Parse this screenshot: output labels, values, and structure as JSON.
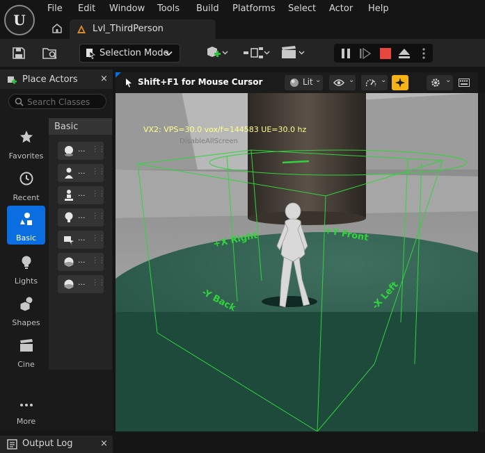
{
  "menu": {
    "items": [
      "File",
      "Edit",
      "Window",
      "Tools",
      "Build",
      "Platforms",
      "Select",
      "Actor",
      "Help"
    ]
  },
  "level_tab": {
    "label": "Lvl_ThirdPerson"
  },
  "toolbar": {
    "selection_mode_label": "Selection Mode",
    "icons": [
      "save-icon",
      "content-browser-icon",
      "add-actor-icon",
      "blueprint-icon",
      "cinematics-icon",
      "pause-icon",
      "step-icon",
      "stop-icon",
      "eject-icon",
      "more-icon"
    ]
  },
  "place_actors": {
    "title": "Place Actors",
    "close_label": "×",
    "search_placeholder": "Search Classes",
    "categories": [
      {
        "label": "Favorites",
        "icon": "star-icon"
      },
      {
        "label": "Recent",
        "icon": "clock-icon"
      },
      {
        "label": "Basic",
        "icon": "shapes-basic-icon",
        "active": true
      },
      {
        "label": "Lights",
        "icon": "lightbulb-icon"
      },
      {
        "label": "Shapes",
        "icon": "cube-icon"
      },
      {
        "label": "Cine",
        "icon": "clapperboard-icon"
      },
      {
        "label": "More",
        "icon": "ellipsis-icon"
      }
    ],
    "list_header": "Basic",
    "actors": [
      {
        "label": "...",
        "icon": "empty-actor-icon"
      },
      {
        "label": "...",
        "icon": "character-icon"
      },
      {
        "label": "...",
        "icon": "pawn-icon"
      },
      {
        "label": "...",
        "icon": "point-light-icon"
      },
      {
        "label": "...",
        "icon": "player-start-icon"
      },
      {
        "label": "...",
        "icon": "sphere-icon"
      },
      {
        "label": "...",
        "icon": "sphere-icon"
      }
    ]
  },
  "output_log": {
    "title": "Output Log",
    "close_label": "×"
  },
  "viewport": {
    "hint": "Shift+F1 for Mouse Cursor",
    "lit_label": "Lit",
    "overlay_text": "VX2: VPS=30.0  vox/f=144583  UE=30.0 hz",
    "faint_text": "DisableAllScreen",
    "gizmo_labels": [
      "+X Right",
      "+Y Front",
      "-Y Back",
      "-X Left"
    ]
  },
  "colors": {
    "accent": "#0a6de0",
    "gizmo": "#31d43c",
    "stop": "#e8473b",
    "lighting_toggle": "#f5b318",
    "overlay_text": "#ffff8a"
  }
}
